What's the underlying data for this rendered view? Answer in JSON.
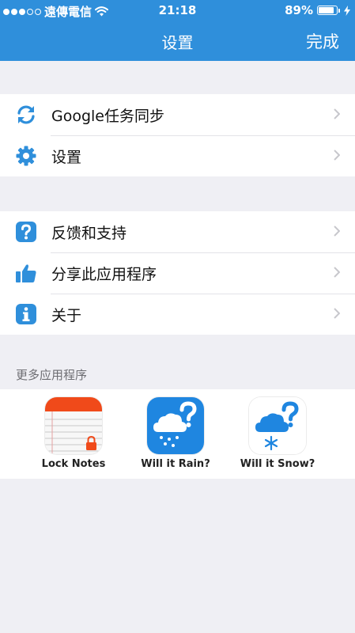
{
  "status_bar": {
    "carrier": "遠傳電信",
    "time": "21:18",
    "battery": "89%",
    "battery_level": 0.89,
    "signal_bars_filled": 3,
    "signal_bars_total": 5
  },
  "nav": {
    "title": "设置",
    "done_label": "完成"
  },
  "group1": [
    {
      "label": "Google任务同步",
      "icon": "sync-icon"
    },
    {
      "label": "设置",
      "icon": "gear-icon"
    }
  ],
  "group2": [
    {
      "label": "反馈和支持",
      "icon": "question-icon"
    },
    {
      "label": "分享此应用程序",
      "icon": "thumbs-up-icon"
    },
    {
      "label": "关于",
      "icon": "info-icon"
    }
  ],
  "more_apps": {
    "header": "更多应用程序",
    "apps": [
      {
        "name": "Lock Notes",
        "icon": "lock-notes-icon"
      },
      {
        "name": "Will it Rain?",
        "icon": "rain-cloud-icon"
      },
      {
        "name": "Will it Snow?",
        "icon": "snow-cloud-icon"
      }
    ]
  },
  "colors": {
    "brand_blue": "#2f8fdb",
    "background": "#efeff4",
    "chevron": "#c7c7cc",
    "lock_notes_red": "#f04a1a"
  }
}
